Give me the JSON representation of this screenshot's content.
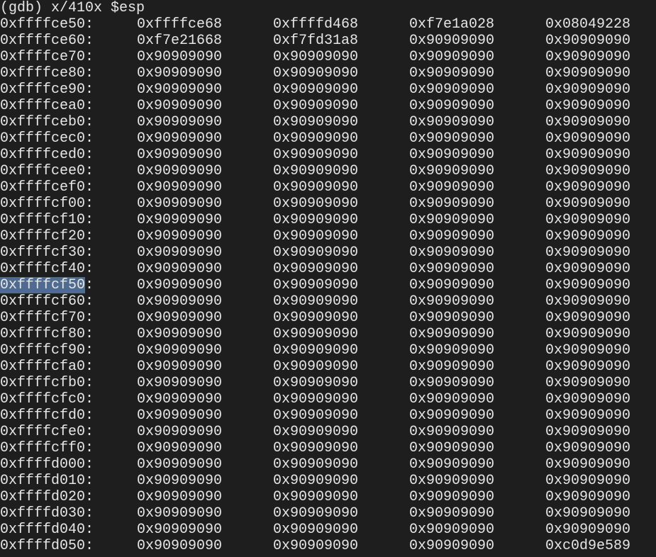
{
  "terminal": {
    "command_line": "(gdb) x/410x $esp",
    "highlight_color": "#4f6b8f",
    "selected_text": "0xffffcf50",
    "rows": [
      {
        "addr": "0xffffce50:",
        "values": [
          "0xffffce68",
          "0xffffd468",
          "0xf7e1a028",
          "0x08049228"
        ]
      },
      {
        "addr": "0xffffce60:",
        "values": [
          "0xf7e21668",
          "0xf7fd31a8",
          "0x90909090",
          "0x90909090"
        ]
      },
      {
        "addr": "0xffffce70:",
        "values": [
          "0x90909090",
          "0x90909090",
          "0x90909090",
          "0x90909090"
        ]
      },
      {
        "addr": "0xffffce80:",
        "values": [
          "0x90909090",
          "0x90909090",
          "0x90909090",
          "0x90909090"
        ]
      },
      {
        "addr": "0xffffce90:",
        "values": [
          "0x90909090",
          "0x90909090",
          "0x90909090",
          "0x90909090"
        ]
      },
      {
        "addr": "0xffffcea0:",
        "values": [
          "0x90909090",
          "0x90909090",
          "0x90909090",
          "0x90909090"
        ]
      },
      {
        "addr": "0xffffceb0:",
        "values": [
          "0x90909090",
          "0x90909090",
          "0x90909090",
          "0x90909090"
        ]
      },
      {
        "addr": "0xffffcec0:",
        "values": [
          "0x90909090",
          "0x90909090",
          "0x90909090",
          "0x90909090"
        ]
      },
      {
        "addr": "0xffffced0:",
        "values": [
          "0x90909090",
          "0x90909090",
          "0x90909090",
          "0x90909090"
        ]
      },
      {
        "addr": "0xffffcee0:",
        "values": [
          "0x90909090",
          "0x90909090",
          "0x90909090",
          "0x90909090"
        ]
      },
      {
        "addr": "0xffffcef0:",
        "values": [
          "0x90909090",
          "0x90909090",
          "0x90909090",
          "0x90909090"
        ]
      },
      {
        "addr": "0xffffcf00:",
        "values": [
          "0x90909090",
          "0x90909090",
          "0x90909090",
          "0x90909090"
        ]
      },
      {
        "addr": "0xffffcf10:",
        "values": [
          "0x90909090",
          "0x90909090",
          "0x90909090",
          "0x90909090"
        ]
      },
      {
        "addr": "0xffffcf20:",
        "values": [
          "0x90909090",
          "0x90909090",
          "0x90909090",
          "0x90909090"
        ]
      },
      {
        "addr": "0xffffcf30:",
        "values": [
          "0x90909090",
          "0x90909090",
          "0x90909090",
          "0x90909090"
        ]
      },
      {
        "addr": "0xffffcf40:",
        "values": [
          "0x90909090",
          "0x90909090",
          "0x90909090",
          "0x90909090"
        ]
      },
      {
        "addr": "0xffffcf50:",
        "values": [
          "0x90909090",
          "0x90909090",
          "0x90909090",
          "0x90909090"
        ]
      },
      {
        "addr": "0xffffcf60:",
        "values": [
          "0x90909090",
          "0x90909090",
          "0x90909090",
          "0x90909090"
        ]
      },
      {
        "addr": "0xffffcf70:",
        "values": [
          "0x90909090",
          "0x90909090",
          "0x90909090",
          "0x90909090"
        ]
      },
      {
        "addr": "0xffffcf80:",
        "values": [
          "0x90909090",
          "0x90909090",
          "0x90909090",
          "0x90909090"
        ]
      },
      {
        "addr": "0xffffcf90:",
        "values": [
          "0x90909090",
          "0x90909090",
          "0x90909090",
          "0x90909090"
        ]
      },
      {
        "addr": "0xffffcfa0:",
        "values": [
          "0x90909090",
          "0x90909090",
          "0x90909090",
          "0x90909090"
        ]
      },
      {
        "addr": "0xffffcfb0:",
        "values": [
          "0x90909090",
          "0x90909090",
          "0x90909090",
          "0x90909090"
        ]
      },
      {
        "addr": "0xffffcfc0:",
        "values": [
          "0x90909090",
          "0x90909090",
          "0x90909090",
          "0x90909090"
        ]
      },
      {
        "addr": "0xffffcfd0:",
        "values": [
          "0x90909090",
          "0x90909090",
          "0x90909090",
          "0x90909090"
        ]
      },
      {
        "addr": "0xffffcfe0:",
        "values": [
          "0x90909090",
          "0x90909090",
          "0x90909090",
          "0x90909090"
        ]
      },
      {
        "addr": "0xffffcff0:",
        "values": [
          "0x90909090",
          "0x90909090",
          "0x90909090",
          "0x90909090"
        ]
      },
      {
        "addr": "0xffffd000:",
        "values": [
          "0x90909090",
          "0x90909090",
          "0x90909090",
          "0x90909090"
        ]
      },
      {
        "addr": "0xffffd010:",
        "values": [
          "0x90909090",
          "0x90909090",
          "0x90909090",
          "0x90909090"
        ]
      },
      {
        "addr": "0xffffd020:",
        "values": [
          "0x90909090",
          "0x90909090",
          "0x90909090",
          "0x90909090"
        ]
      },
      {
        "addr": "0xffffd030:",
        "values": [
          "0x90909090",
          "0x90909090",
          "0x90909090",
          "0x90909090"
        ]
      },
      {
        "addr": "0xffffd040:",
        "values": [
          "0x90909090",
          "0x90909090",
          "0x90909090",
          "0x90909090"
        ]
      },
      {
        "addr": "0xffffd050:",
        "values": [
          "0x90909090",
          "0x90909090",
          "0x90909090",
          "0xc0d9e589"
        ]
      }
    ]
  }
}
